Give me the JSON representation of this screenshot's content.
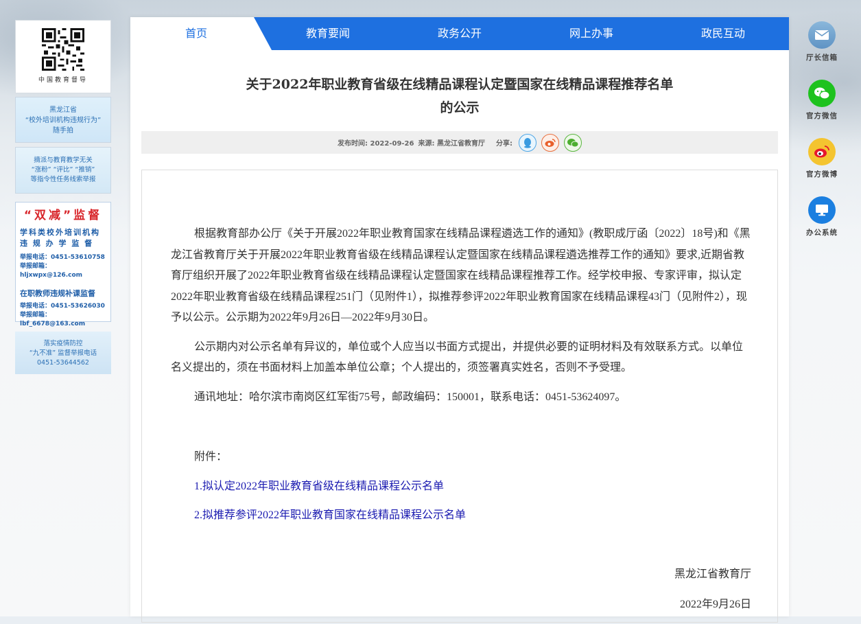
{
  "left": {
    "qr_caption": "中国教育督导",
    "banner1": [
      "黑龙江省",
      "“校外培训机构违规行为”",
      "随手拍"
    ],
    "banner2": [
      "摘派与教育教学无关",
      "“涨粉” “评比” “推销”",
      "等指令性任务线索举报"
    ],
    "banner3": {
      "title": "“双减”监督",
      "line1": "学科类校外培训机构",
      "line2": "违 规 办 学 监 督",
      "phone1": "举报电话：0451-53610758",
      "email1": "举报邮箱：hljxwpx@126.com",
      "line3": "在职教师违规补课监督",
      "phone2": "举报电话：0451-53626030",
      "email2": "举报邮箱：lbf_6678@163.com"
    },
    "banner4": [
      "落实疫情防控",
      "“九不准” 监督举报电话",
      "0451-53644562"
    ]
  },
  "nav": {
    "items": [
      "首页",
      "教育要闻",
      "政务公开",
      "网上办事",
      "政民互动"
    ]
  },
  "article": {
    "title_line1": "关于2022年职业教育省级在线精品课程认定暨国家在线精品课程推荐名单",
    "title_line2": "的公示",
    "meta": {
      "date": "发布时间: 2022-09-26",
      "source": "来源: 黑龙江省教育厅",
      "share_label": "分享:"
    },
    "para1": "根据教育部办公厅《关于开展2022年职业教育国家在线精品课程遴选工作的通知》(教职成厅函〔2022〕18号)和《黑龙江省教育厅关于开展2022年职业教育省级在线精品课程认定暨国家在线精品课程遴选推荐工作的通知》要求,近期省教育厅组织开展了2022年职业教育省级在线精品课程认定暨国家在线精品课程推荐工作。经学校申报、专家评审，拟认定2022年职业教育省级在线精品课程251门（见附件1），拟推荐参评2022年职业教育国家在线精品课程43门（见附件2），现予以公示。公示期为2022年9月26日—2022年9月30日。",
    "para2": "公示期内对公示名单有异议的，单位或个人应当以书面方式提出，并提供必要的证明材料及有效联系方式。以单位名义提出的，须在书面材料上加盖本单位公章；个人提出的，须签署真实姓名，否则不予受理。",
    "para3": "通讯地址：哈尔滨市南岗区红军街75号，邮政编码：150001，联系电话：0451-53624097。",
    "attach_label": "附件：",
    "attach1": "1.拟认定2022年职业教育省级在线精品课程公示名单",
    "attach2": "2.拟推荐参评2022年职业教育国家在线精品课程公示名单",
    "sign_org": "黑龙江省教育厅",
    "sign_date": "2022年9月26日"
  },
  "right": {
    "items": [
      "厅长信箱",
      "官方微信",
      "官方微博",
      "办公系统"
    ]
  }
}
